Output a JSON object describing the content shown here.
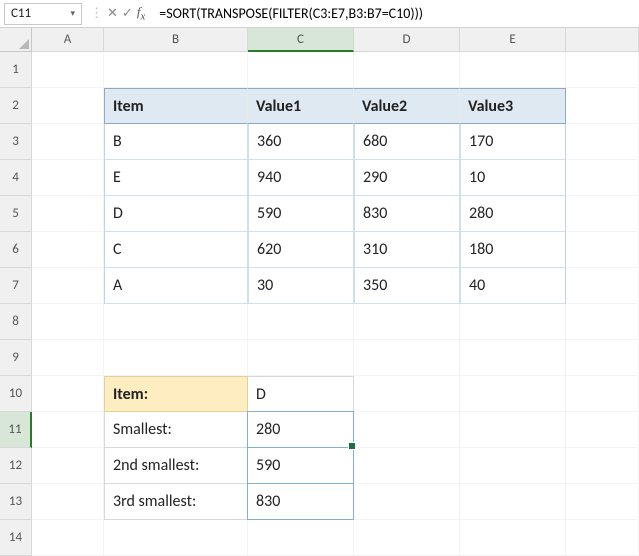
{
  "namebox": {
    "value": "C11"
  },
  "formula": "=SORT(TRANSPOSE(FILTER(C3:E7,B3:B7=C10)))",
  "columns": [
    "A",
    "B",
    "C",
    "D",
    "E"
  ],
  "row_labels": [
    "1",
    "2",
    "3",
    "4",
    "5",
    "6",
    "7",
    "8",
    "9",
    "10",
    "11",
    "12",
    "13",
    "14"
  ],
  "table": {
    "headers": [
      "Item",
      "Value1",
      "Value2",
      "Value3"
    ],
    "rows": [
      {
        "item": "B",
        "v1": "360",
        "v2": "680",
        "v3": "170"
      },
      {
        "item": "E",
        "v1": "940",
        "v2": "290",
        "v3": "10"
      },
      {
        "item": "D",
        "v1": "590",
        "v2": "830",
        "v3": "280"
      },
      {
        "item": "C",
        "v1": "620",
        "v2": "310",
        "v3": "180"
      },
      {
        "item": "A",
        "v1": "30",
        "v2": "350",
        "v3": "40"
      }
    ]
  },
  "lookup": {
    "item_label": "Item:",
    "item_value": "D",
    "entries": [
      {
        "label": "Smallest:",
        "value": "280"
      },
      {
        "label": "2nd smallest:",
        "value": "590"
      },
      {
        "label": "3rd smallest:",
        "value": "830"
      }
    ]
  }
}
